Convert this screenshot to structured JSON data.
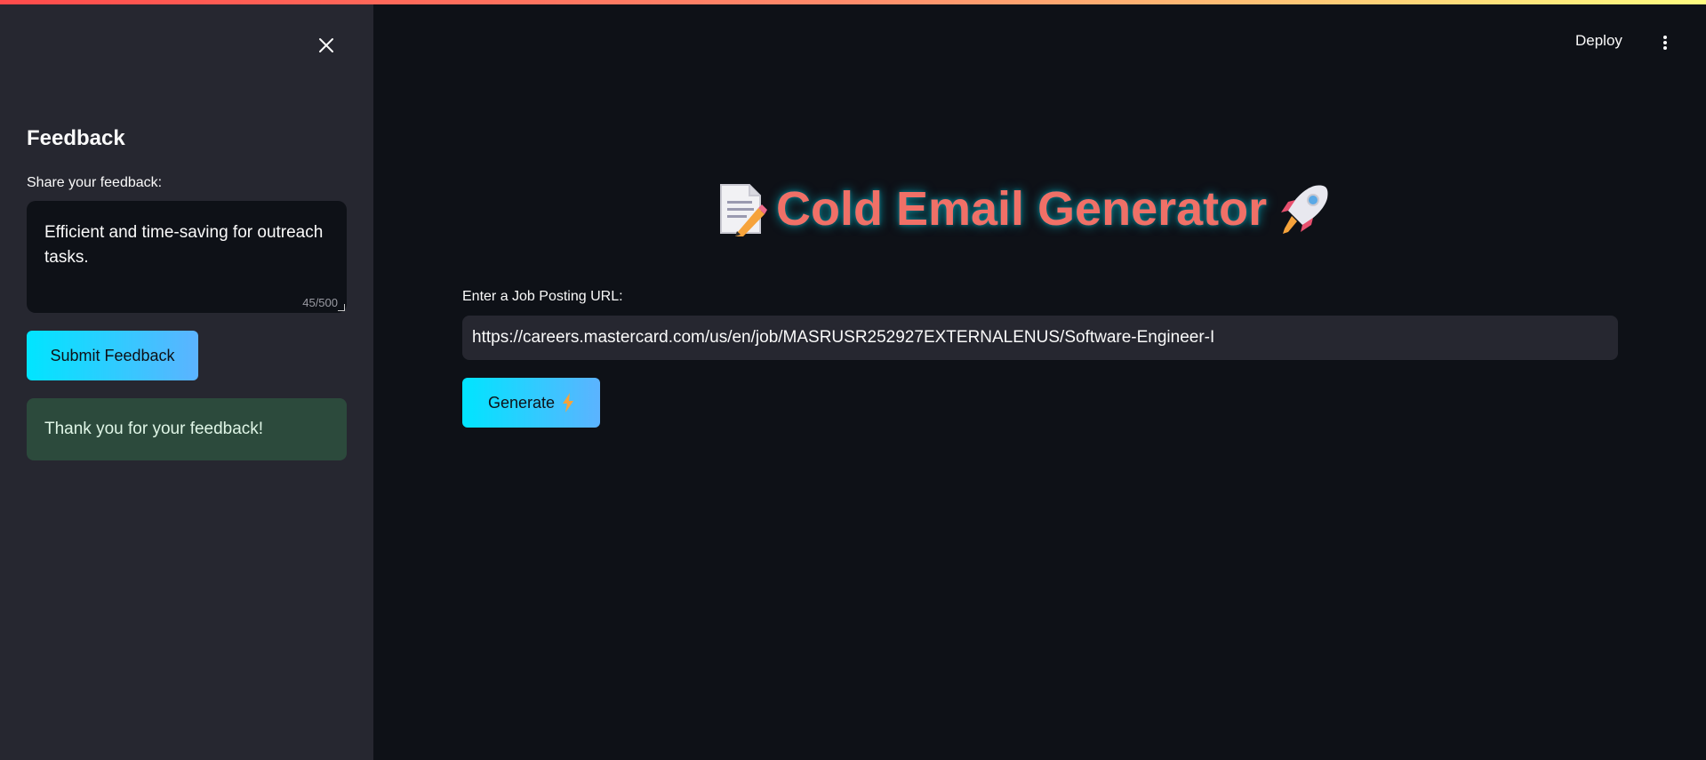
{
  "sidebar": {
    "title": "Feedback",
    "feedback_label": "Share your feedback:",
    "feedback_text": "Efficient and time-saving for outreach tasks.",
    "char_count": "45/500",
    "submit_label": "Submit Feedback",
    "success_message": "Thank you for your feedback!"
  },
  "header": {
    "deploy_label": "Deploy"
  },
  "main": {
    "title": "Cold Email Generator",
    "url_label": "Enter a Job Posting URL:",
    "url_value": "https://careers.mastercard.com/us/en/job/MASRUSR252927EXTERNALENUS/Software-Engineer-I",
    "generate_label": "Generate"
  },
  "colors": {
    "accent_gradient_start": "#00e5ff",
    "accent_gradient_end": "#5cb3ff",
    "title_color": "#f07067",
    "sidebar_bg": "#262730",
    "main_bg": "#0e1117",
    "success_bg": "#2c4a3c"
  },
  "icons": [
    "close-icon",
    "memo-icon",
    "rocket-icon",
    "lightning-icon",
    "kebab-menu-icon"
  ]
}
